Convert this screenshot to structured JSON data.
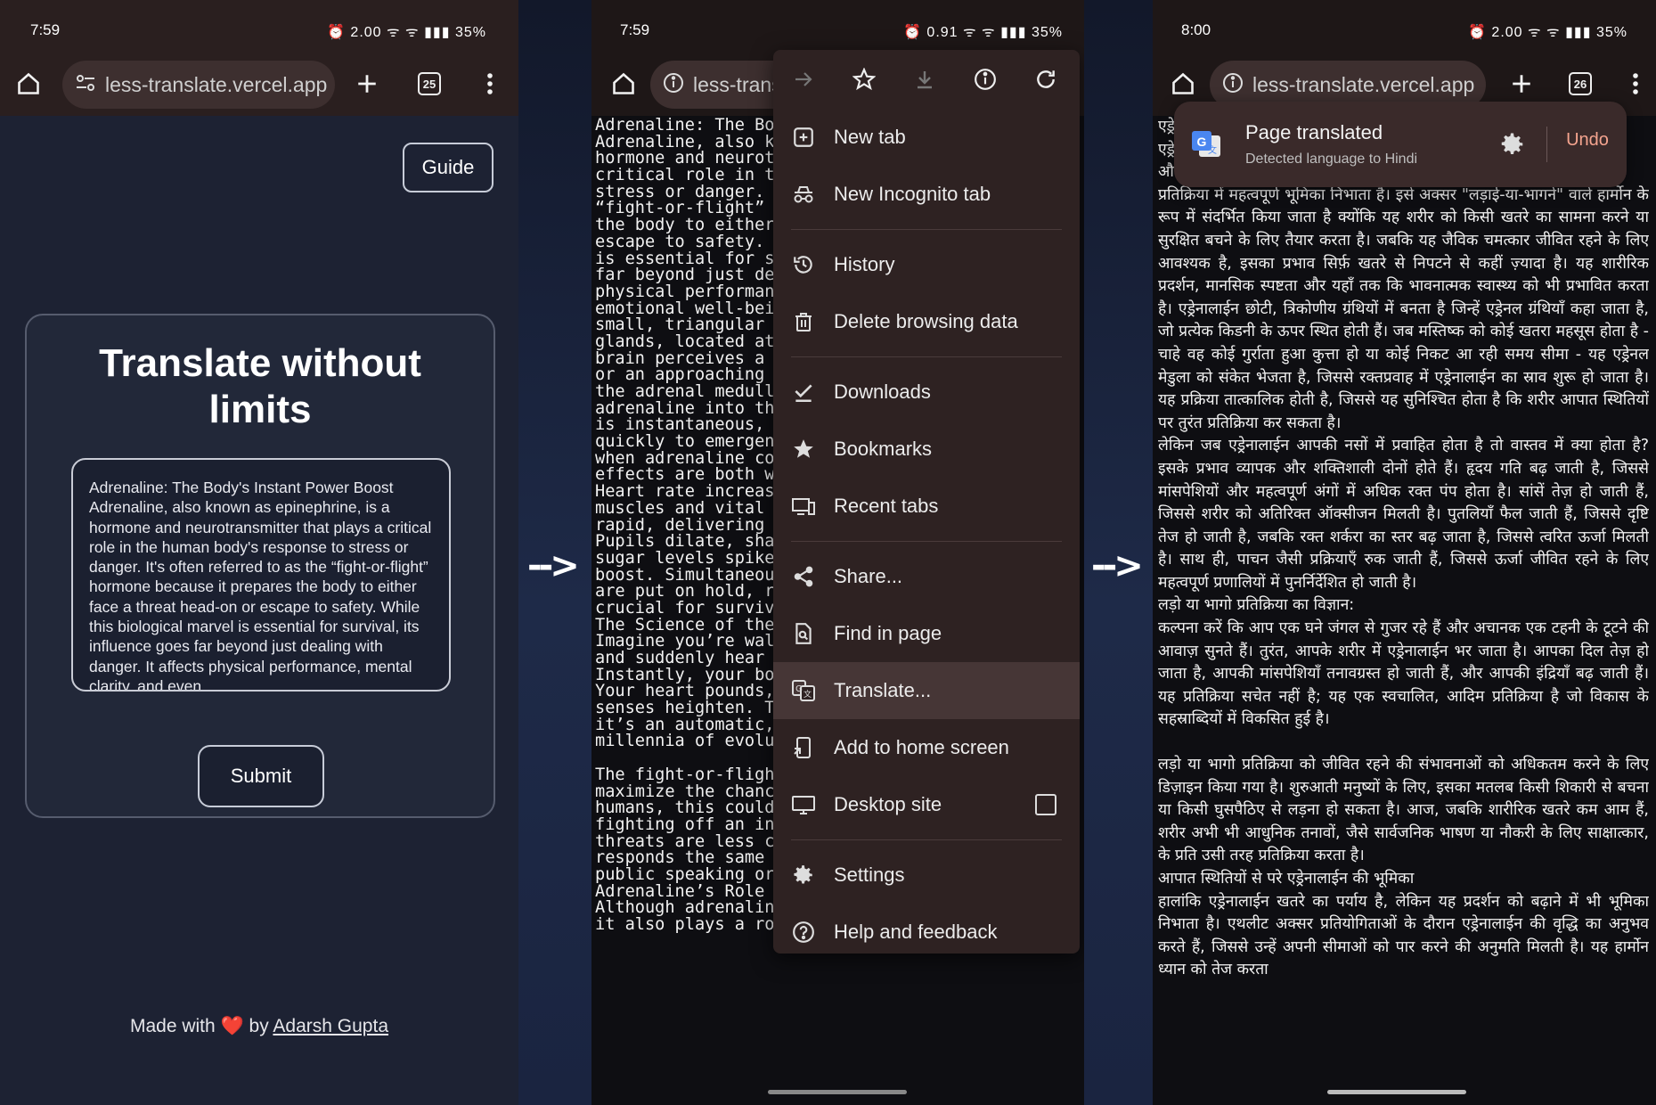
{
  "status": {
    "p1_time": "7:59",
    "p2_time": "7:59",
    "p3_time": "8:00",
    "battery": "35%",
    "p1_icons": "⏰ 2.00 ᯤ ᯤ ▮▮▮ 35%",
    "p2_icons": "⏰ 0.91 ᯤ ᯤ ▮▮▮ 35%",
    "p3_icons": "⏰ 2.00 ᯤ ᯤ ▮▮▮ 35%"
  },
  "browser": {
    "url": "less-translate.vercel.app",
    "url_short": "less-trans",
    "tab_count_p1": "25",
    "tab_count_p3": "26",
    "icons": [
      "home-icon",
      "site-settings-icon",
      "info-icon",
      "plus-icon",
      "tab-switcher-icon",
      "more-vert-icon",
      "forward-icon",
      "star-icon",
      "download-icon",
      "refresh-icon"
    ]
  },
  "app": {
    "guide_label": "Guide",
    "heading": "Translate without limits",
    "input_text": "Adrenaline: The Body's Instant Power Boost Adrenaline, also known as epinephrine, is a hormone and neurotransmitter that plays a critical role in the human body's response to stress or danger. It's often referred to as the “fight-or-flight” hormone because it prepares the body to either face a threat head-on or escape to safety. While this biological marvel is essential for survival, its influence goes far beyond just dealing with danger. It affects physical performance, mental clarity, and even",
    "submit_label": "Submit",
    "footer_prefix": "Made with",
    "footer_heart": "❤️",
    "footer_by": "by",
    "footer_author": "Adarsh Gupta"
  },
  "arrow": "-->",
  "english_page": {
    "lines": [
      "Adrenaline: The Bo",
      "Adrenaline, also k",
      "hormone and neurot",
      "critical role in t",
      "stress or danger.",
      "“fight-or-flight”",
      "the body to either",
      "escape to safety.",
      "is essential for s",
      "far beyond just de",
      "physical performan",
      "emotional well-bei",
      "small, triangular",
      "glands, located at",
      "brain perceives a",
      "or an approaching",
      "the adrenal medull",
      "adrenaline into th",
      "is instantaneous,",
      "quickly to emergen",
      "when adrenaline co",
      "effects are both w",
      "Heart rate increas",
      "muscles and vital",
      "rapid, delivering",
      "Pupils dilate, sha",
      "sugar levels spike",
      "boost. Simultaneou",
      "are put on hold, r",
      "crucial for surviv",
      "The Science of the",
      "Imagine you’re wal",
      "and suddenly hear",
      "Instantly, your bo",
      "Your heart pounds,",
      "senses heighten. T",
      "it’s an automatic,",
      "millennia of evolu",
      "",
      "The fight-or-fligh",
      "maximize the chanc",
      "humans, this could",
      "fighting off an intruder. Today, while physical",
      "threats are less common, the body still",
      "responds the same way to modern stressors, like",
      "public speaking or a job interview.",
      "Adrenaline’s Role Beyond Emergencies",
      "Although adrenaline is synonymous with danger,",
      "it also plays a role in enhancing performance."
    ]
  },
  "menu": {
    "items": [
      {
        "label": "New tab",
        "icon": "new-tab-icon"
      },
      {
        "label": "New Incognito tab",
        "icon": "incognito-icon"
      },
      {
        "label": "History",
        "icon": "history-icon"
      },
      {
        "label": "Delete browsing data",
        "icon": "trash-icon"
      },
      {
        "label": "Downloads",
        "icon": "downloads-check-icon"
      },
      {
        "label": "Bookmarks",
        "icon": "bookmark-star-icon"
      },
      {
        "label": "Recent tabs",
        "icon": "recent-tabs-icon"
      },
      {
        "label": "Share...",
        "icon": "share-icon"
      },
      {
        "label": "Find in page",
        "icon": "find-in-page-icon"
      },
      {
        "label": "Translate...",
        "icon": "translate-icon"
      },
      {
        "label": "Add to home screen",
        "icon": "add-to-home-icon"
      },
      {
        "label": "Desktop site",
        "icon": "desktop-icon"
      },
      {
        "label": "Settings",
        "icon": "settings-gear-icon"
      },
      {
        "label": "Help and feedback",
        "icon": "help-icon"
      }
    ],
    "desktop_site_checked": false
  },
  "translated_page": {
    "toast_title": "Page translated",
    "toast_subtitle": "Detected language to Hindi",
    "undo_label": "Undo",
    "paragraphs": [
      "एड्रे",
      "एड्रे",
      "औ",
      "प्रतिक्रिया में महत्वपूर्ण भूमिका निभाता है। इसे अक्सर \"लड़ाई-या-भागने\" वाले हार्मोन के रूप में संदर्भित किया जाता है क्योंकि यह शरीर को किसी खतरे का सामना करने या सुरक्षित बचने के लिए तैयार करता है। जबकि यह जैविक चमत्कार जीवित रहने के लिए आवश्यक है, इसका प्रभाव सिर्फ़ खतरे से निपटने से कहीं ज़्यादा है। यह शारीरिक प्रदर्शन, मानसिक स्पष्टता और यहाँ तक कि भावनात्मक स्वास्थ्य को भी प्रभावित करता है। एड्रेनालाईन छोटी, त्रिकोणीय ग्रंथियों में बनता है जिन्हें एड्रेनल ग्रंथियाँ कहा जाता है, जो प्रत्येक किडनी के ऊपर स्थित होती हैं। जब मस्तिष्क को कोई खतरा महसूस होता है - चाहे वह कोई गुर्राता हुआ कुत्ता हो या कोई निकट आ रही समय सीमा - यह एड्रेनल मेडुला को संकेत भेजता है, जिससे रक्तप्रवाह में एड्रेनालाईन का स्राव शुरू हो जाता है। यह प्रक्रिया तात्कालिक होती है, जिससे यह सुनिश्चित होता है कि शरीर आपात स्थितियों पर तुरंत प्रतिक्रिया कर सकता है।",
      "लेकिन जब एड्रेनालाईन आपकी नसों में प्रवाहित होता है तो वास्तव में क्या होता है? इसके प्रभाव व्यापक और शक्तिशाली दोनों होते हैं। हृदय गति बढ़ जाती है, जिससे मांसपेशियों और महत्वपूर्ण अंगों में अधिक रक्त पंप होता है। सांसें तेज़ हो जाती हैं, जिससे शरीर को अतिरिक्त ऑक्सीजन मिलती है। पुतलियाँ फैल जाती हैं, जिससे दृष्टि तेज हो जाती है, जबकि रक्त शर्करा का स्तर बढ़ जाता है, जिससे त्वरित ऊर्जा मिलती है। साथ ही, पाचन जैसी प्रक्रियाएँ रुक जाती हैं, जिससे ऊर्जा जीवित रहने के लिए महत्वपूर्ण प्रणालियों में पुनर्निर्देशित हो जाती है।",
      "लड़ो या भागो प्रतिक्रिया का विज्ञान:",
      "कल्पना करें कि आप एक घने जंगल से गुजर रहे हैं और अचानक एक टहनी के टूटने की आवाज़ सुनते हैं। तुरंत, आपके शरीर में एड्रेनालाईन भर जाता है। आपका दिल तेज़ हो जाता है, आपकी मांसपेशियाँ तनावग्रस्त हो जाती हैं, और आपकी इंद्रियाँ बढ़ जाती हैं। यह प्रतिक्रिया सचेत नहीं है; यह एक स्वचालित, आदिम प्रतिक्रिया है जो विकास के सहस्राब्दियों में विकसित हुई है।",
      "",
      "लड़ो या भागो प्रतिक्रिया को जीवित रहने की संभावनाओं को अधिकतम करने के लिए डिज़ाइन किया गया है। शुरुआती मनुष्यों के लिए, इसका मतलब किसी शिकारी से बचना या किसी घुसपैठिए से लड़ना हो सकता है। आज, जबकि शारीरिक खतरे कम आम हैं, शरीर अभी भी आधुनिक तनावों, जैसे सार्वजनिक भाषण या नौकरी के लिए साक्षात्कार, के प्रति उसी तरह प्रतिक्रिया करता है।",
      "आपात स्थितियों से परे एड्रेनालाईन की भूमिका",
      "हालांकि एड्रेनालाईन खतरे का पर्याय है, लेकिन यह प्रदर्शन को बढ़ाने में भी भूमिका निभाता है। एथलीट अक्सर प्रतियोगिताओं के दौरान एड्रेनालाईन की वृद्धि का अनुभव करते हैं, जिससे उन्हें अपनी सीमाओं को पार करने की अनुमति मिलती है। यह हार्मोन ध्यान को तेज करता"
    ]
  },
  "colors": {
    "page_bg": "#1d2233",
    "browser_bar": "#2a1f1f",
    "menu_bg": "#2e2222",
    "undo": "#f5a48f",
    "heart": "#e03c3c"
  }
}
